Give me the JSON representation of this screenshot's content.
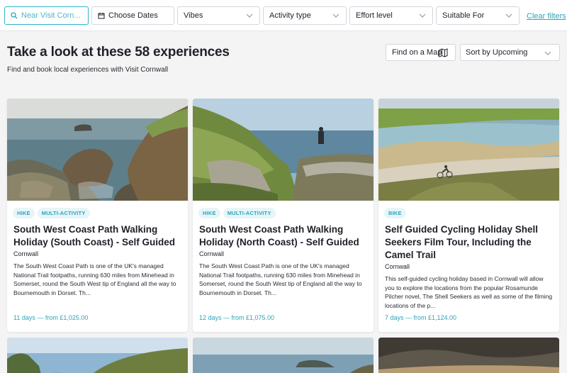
{
  "filters": {
    "search_placeholder": "Near Visit Corn...",
    "dates_label": "Choose Dates",
    "vibes_label": "Vibes",
    "activity_label": "Activity type",
    "effort_label": "Effort level",
    "suitable_label": "Suitable For",
    "clear_label": "Clear filters"
  },
  "header": {
    "title": "Take a look at these 58 experiences",
    "subtitle": "Find and book local experiences with Visit Cornwall",
    "map_label": "Find on a Map",
    "sort_label": "Sort by Upcoming"
  },
  "colors": {
    "accent": "#2aa5b8",
    "tag_bg": "#e5f5f8"
  },
  "cards": [
    {
      "tags": [
        "HIKE",
        "MULTI-ACTIVITY"
      ],
      "title": "South West Coast Path Walking Holiday (South Coast) - Self Guided",
      "location": "Cornwall",
      "description": "The South West Coast Path is one of the UK's managed National Trail footpaths, running 630 miles from Minehead in Somerset, round the South West tip of England all the way to Bournemouth in Dorset. Th...",
      "price": "11 days — from £1,025.00"
    },
    {
      "tags": [
        "HIKE",
        "MULTI-ACTIVITY"
      ],
      "title": "South West Coast Path Walking Holiday (North Coast) - Self Guided",
      "location": "Cornwall",
      "description": "The South West Coast Path is one of the UK's managed National Trail footpaths, running 630 miles from Minehead in Somerset, round the South West tip of England all the way to Bournemouth in Dorset. Th...",
      "price": "12 days — from £1,075.00"
    },
    {
      "tags": [
        "BIKE"
      ],
      "title": "Self Guided Cycling Holiday Shell Seekers Film Tour, Including the Camel Trail",
      "location": "Cornwall",
      "description": "This self-guided cycling holiday based in Cornwall will allow you to explore the locations from the popular Rosamunde Pilcher novel, The Shell Seekers as well as some of the filming locations of the p...",
      "price": "7 days — from £1,124.00"
    }
  ]
}
